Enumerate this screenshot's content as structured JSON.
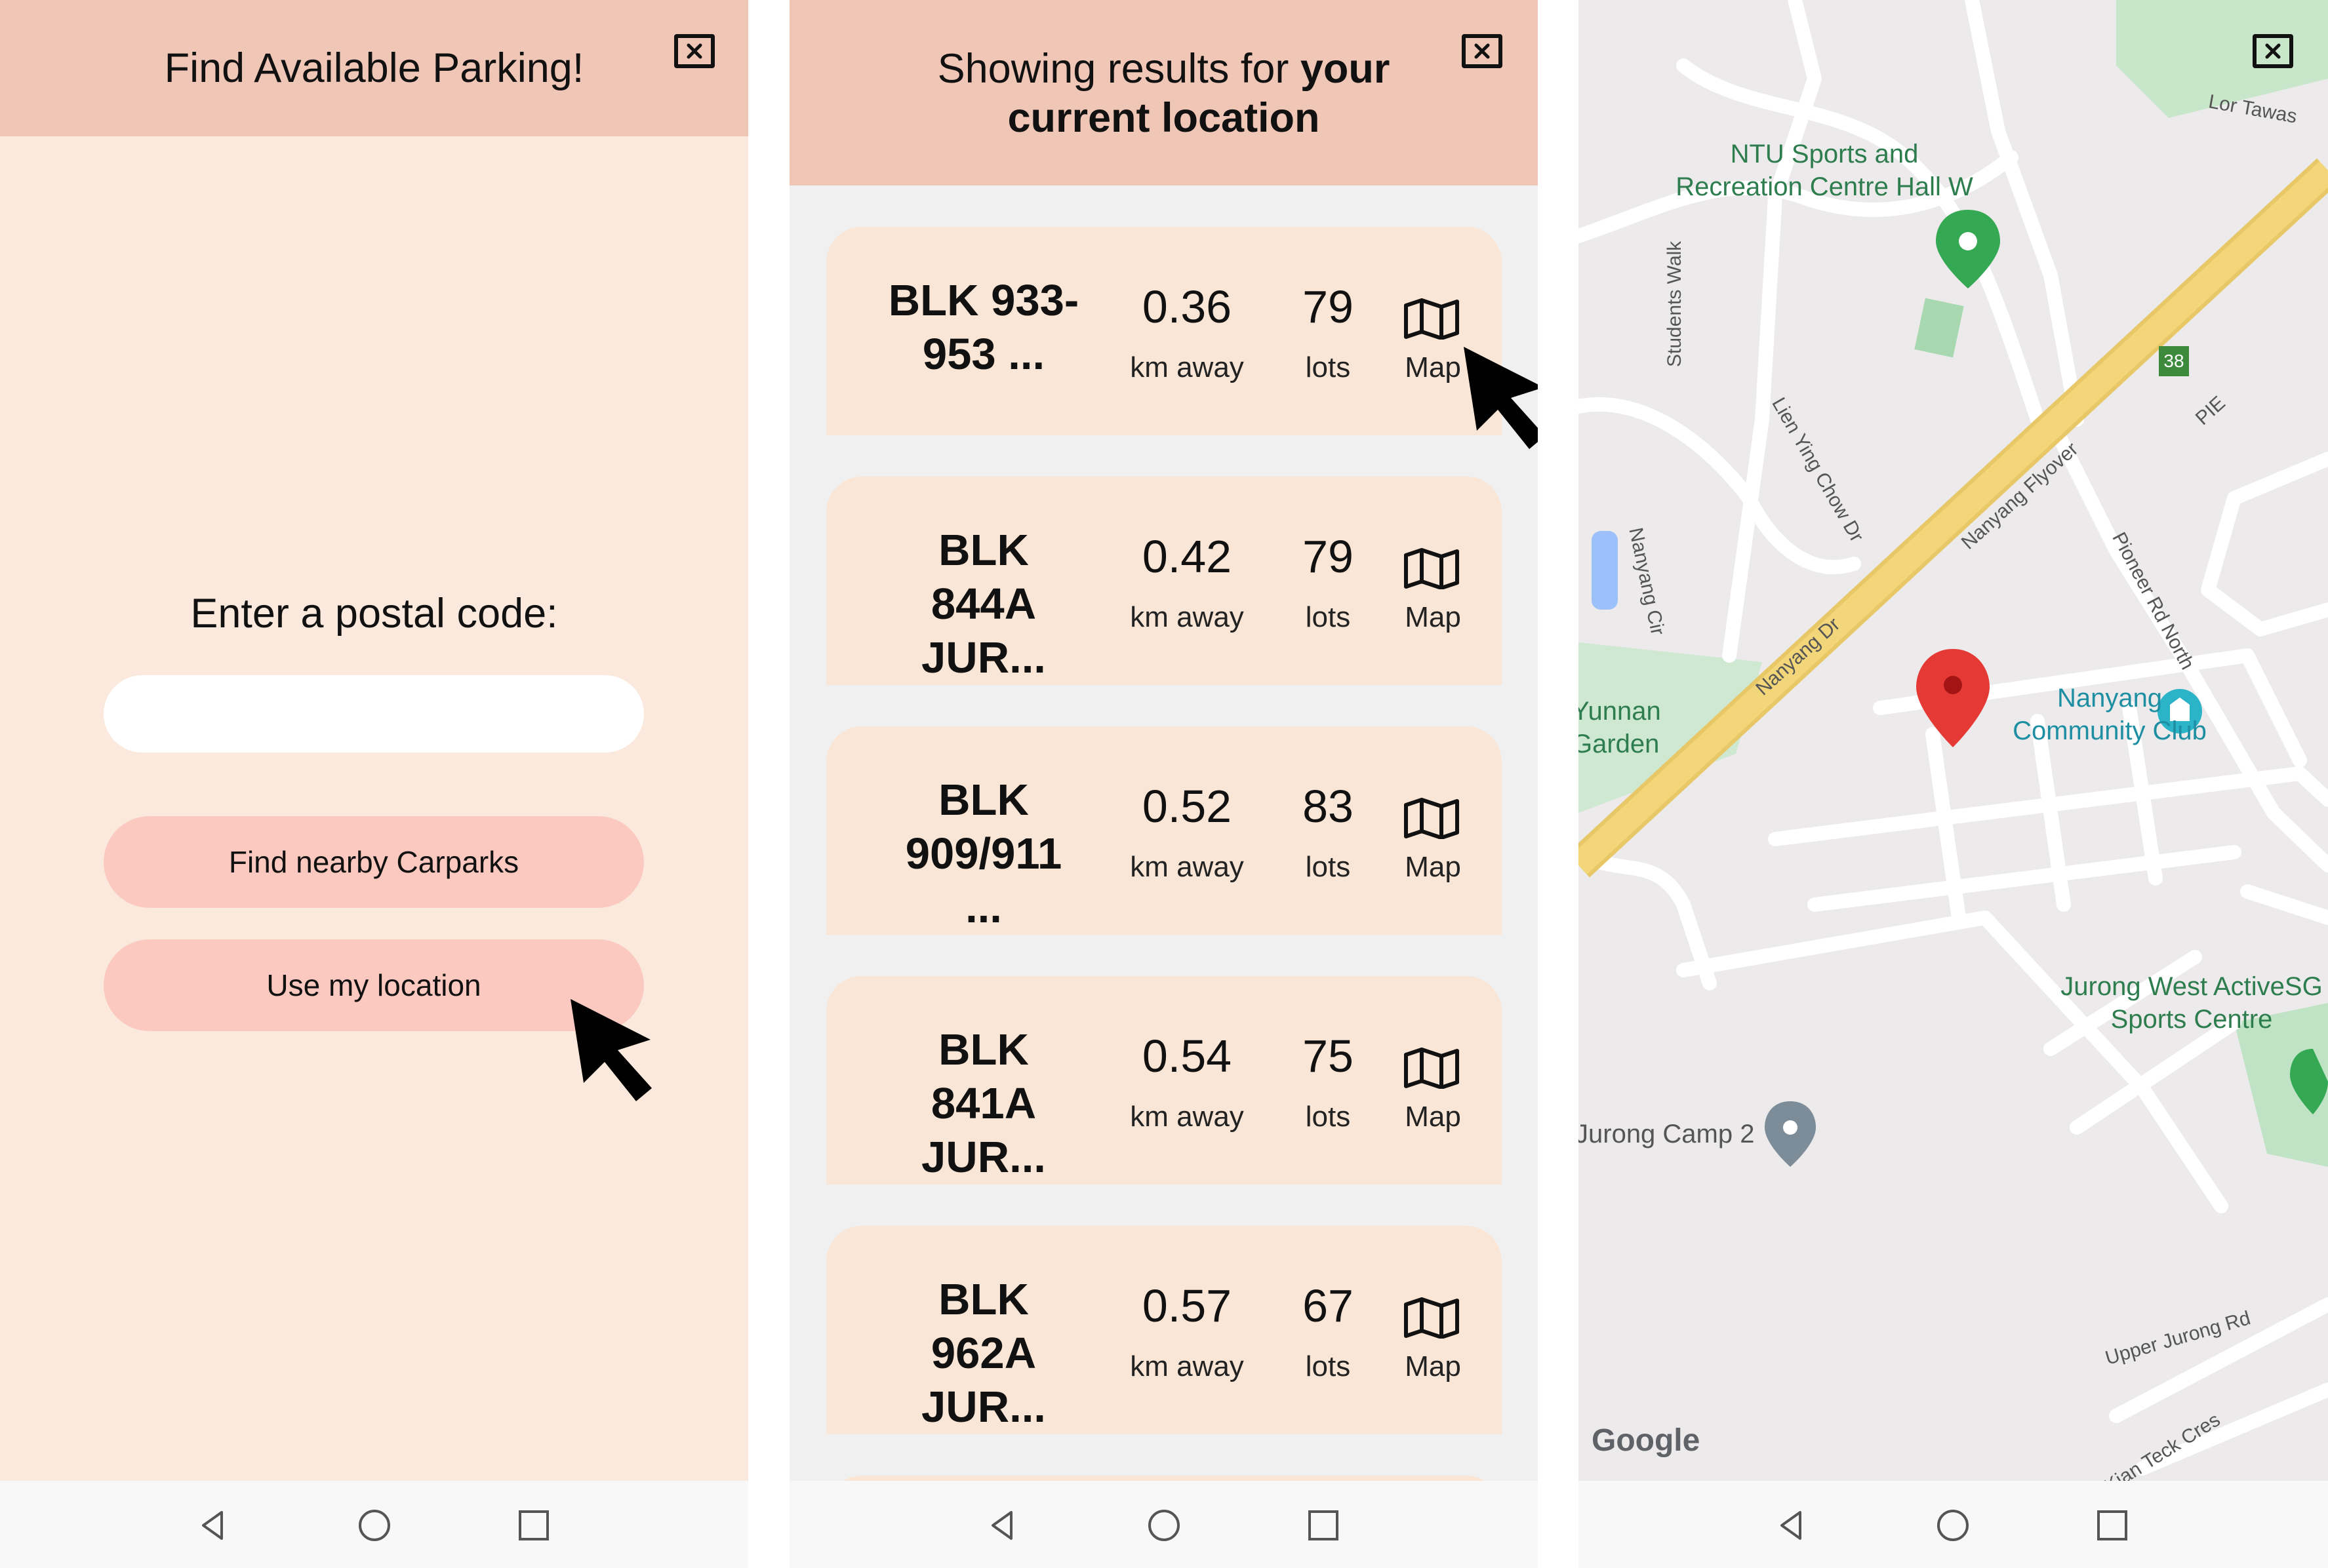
{
  "screen1": {
    "title": "Find Available Parking!",
    "postal_label": "Enter a postal code:",
    "postal_input": {
      "value": "",
      "placeholder": ""
    },
    "buttons": {
      "find": "Find nearby Carparks",
      "location": "Use my location"
    },
    "icons": {
      "close": "close-icon",
      "cursor": "cursor-icon"
    }
  },
  "screen2": {
    "title_prefix": "Showing results for ",
    "title_bold": "your current location",
    "results": [
      {
        "name": "BLK 933-953 ...",
        "distance": "0.36",
        "distance_unit": "km away",
        "lots": "79",
        "lots_unit": "lots",
        "map_label": "Map"
      },
      {
        "name": "BLK 844A JUR...",
        "distance": "0.42",
        "distance_unit": "km away",
        "lots": "79",
        "lots_unit": "lots",
        "map_label": "Map"
      },
      {
        "name": "BLK 909/911 ...",
        "distance": "0.52",
        "distance_unit": "km away",
        "lots": "83",
        "lots_unit": "lots",
        "map_label": "Map"
      },
      {
        "name": "BLK 841A JUR...",
        "distance": "0.54",
        "distance_unit": "km away",
        "lots": "75",
        "lots_unit": "lots",
        "map_label": "Map"
      },
      {
        "name": "BLK 962A JUR...",
        "distance": "0.57",
        "distance_unit": "km away",
        "lots": "67",
        "lots_unit": "lots",
        "map_label": "Map"
      }
    ]
  },
  "screen3": {
    "places": {
      "ntu": "NTU Sports and Recreation Centre Hall W",
      "community": "Nanyang Community Club",
      "jurong_west": "Jurong West ActiveSG Sports Centre",
      "camp": "Jurong Camp 2",
      "yunnan": "Yunnan Garden"
    },
    "streets": {
      "lor_tawas": "Lor Tawas",
      "students_walk": "Students Walk",
      "lien_ying": "Lien Ying Chow Dr",
      "nanyang_cir": "Nanyang Cir",
      "nanyang_dr": "Nanyang Dr",
      "nanyang_flyover": "Nanyang Flyover",
      "pie": "PIE",
      "pioneer": "Pioneer Rd North",
      "upper_jurong": "Upper Jurong Rd",
      "kian_teck": "Kian Teck Cres"
    },
    "exit_badge": "38",
    "google_logo": "Google",
    "colors": {
      "marker": "#e53935",
      "park_pin": "#34a853",
      "highway": "#f4d67a"
    }
  }
}
